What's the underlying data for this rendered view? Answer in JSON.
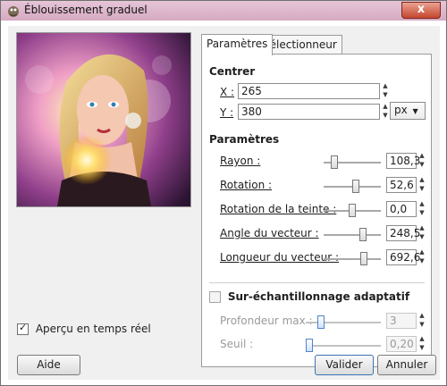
{
  "window": {
    "title": "Éblouissement graduel",
    "close_glyph": "x"
  },
  "preview": {
    "checkbox_label": "Aperçu en temps réel",
    "checked": true
  },
  "tabs": [
    {
      "label": "Paramètres",
      "active": true
    },
    {
      "label": "Sélectionneur",
      "active": false
    }
  ],
  "centrer": {
    "title": "Centrer",
    "x_label": "X :",
    "x_value": "265",
    "y_label": "Y :",
    "y_value": "380",
    "unit": "px"
  },
  "parametres": {
    "title": "Paramètres",
    "rows": [
      {
        "label": "Rayon :",
        "value": "108,3",
        "fraction": 0.18
      },
      {
        "label": "Rotation :",
        "value": "52,6",
        "fraction": 0.57
      },
      {
        "label": "Rotation de la teinte :",
        "value": "0,0",
        "fraction": 0.5
      },
      {
        "label": "Angle du vecteur :",
        "value": "248,5",
        "fraction": 0.69
      },
      {
        "label": "Longueur du vecteur :",
        "value": "692,6",
        "fraction": 0.7
      }
    ]
  },
  "adaptive": {
    "label": "Sur-échantillonnage adaptatif",
    "checked": false,
    "max_depth_label": "Profondeur max :",
    "max_depth_value": "3",
    "max_depth_fraction": 0.2,
    "threshold_label": "Seuil :",
    "threshold_value": "0,20",
    "threshold_fraction": 0.05
  },
  "buttons": {
    "help": "Aide",
    "ok": "Valider",
    "cancel": "Annuler"
  }
}
